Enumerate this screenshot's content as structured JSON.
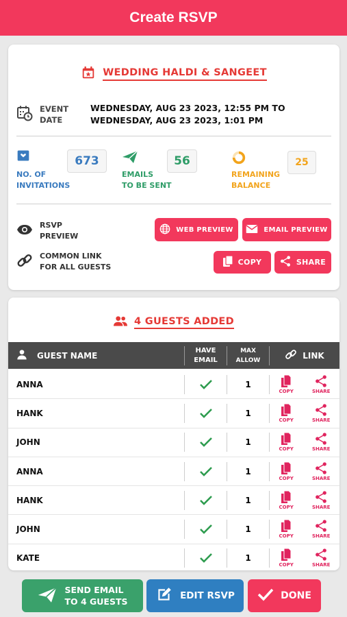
{
  "header": {
    "title": "Create RSVP"
  },
  "event": {
    "title": "WEDDING HALDI & SANGEET",
    "date_label_1": "EVENT",
    "date_label_2": "DATE",
    "date_from": "WEDNESDAY, AUG 23 2023, 12:55 PM TO",
    "date_to": "WEDNESDAY, AUG 23 2023, 1:01 PM"
  },
  "stats": {
    "invitations": {
      "label_1": "NO. OF",
      "label_2": "INVITATIONS",
      "value": "673",
      "color": "#3a7bbf"
    },
    "emails": {
      "label_1": "EMAILS",
      "label_2": "TO BE SENT",
      "value": "56",
      "color": "#2e9c67"
    },
    "balance": {
      "label_1": "REMAINING",
      "label_2": "BALANCE",
      "value": "25",
      "color": "#f2a41c"
    }
  },
  "preview": {
    "label_1": "RSVP",
    "label_2": "PREVIEW",
    "web_button": "WEB PREVIEW",
    "email_button": "EMAIL PREVIEW"
  },
  "common_link": {
    "label_1": "COMMON LINK",
    "label_2": "FOR ALL GUESTS",
    "copy_button": "COPY",
    "share_button": "SHARE"
  },
  "guests": {
    "title": "4 GUESTS ADDED",
    "columns": {
      "name": "GUEST NAME",
      "email_1": "HAVE",
      "email_2": "EMAIL",
      "max_1": "MAX",
      "max_2": "ALLOW",
      "link": "LINK"
    },
    "copy_label": "COPY",
    "share_label": "SHARE",
    "rows": [
      {
        "name": "ANNA",
        "max": "1"
      },
      {
        "name": "HANK",
        "max": "1"
      },
      {
        "name": "JOHN",
        "max": "1"
      },
      {
        "name": "ANNA",
        "max": "1"
      },
      {
        "name": "HANK",
        "max": "1"
      },
      {
        "name": "JOHN",
        "max": "1"
      },
      {
        "name": "KATE",
        "max": "1"
      }
    ]
  },
  "footer": {
    "send_1": "SEND EMAIL",
    "send_2": "TO 4 GUESTS",
    "edit": "EDIT RSVP",
    "done": "DONE"
  },
  "colors": {
    "accent": "#f2385c",
    "green": "#3aa16b",
    "blue": "#2f7fc1",
    "dark": "#4a4a4a"
  }
}
